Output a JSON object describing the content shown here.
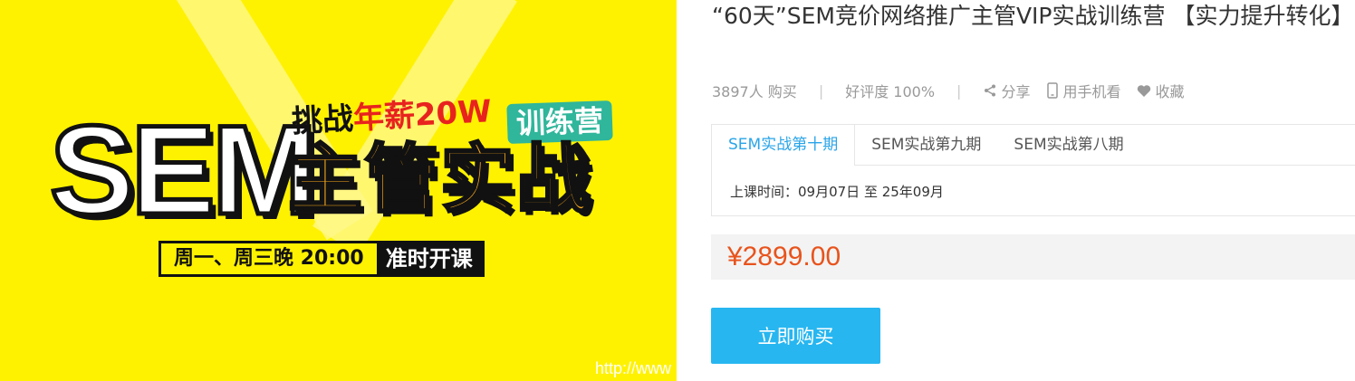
{
  "banner": {
    "sem_text": "SEM",
    "challenge_part1": "挑战",
    "challenge_part2": "年薪20W",
    "camp_badge": "训练营",
    "main_title": "主管实战",
    "schedule_time": "周一、周三晚 20:00",
    "schedule_open": "准时开课",
    "watermark": "http://www"
  },
  "product": {
    "title": "“60天”SEM竞价网络推广主管VIP实战训练营 【实力提升转化】",
    "buyers": "3897人 购买",
    "rating": "好评度 100%",
    "actions": {
      "share": "分享",
      "mobile": "用手机看",
      "favorite": "收藏"
    }
  },
  "tabs": [
    {
      "label": "SEM实战第十期",
      "active": true
    },
    {
      "label": "SEM实战第九期",
      "active": false
    },
    {
      "label": "SEM实战第八期",
      "active": false
    }
  ],
  "schedule_text": "上课时间：09月07日 至 25年09月",
  "price": "¥2899.00",
  "buy_label": "立即购买",
  "colors": {
    "banner_bg": "#fff200",
    "accent_blue": "#27b6f0",
    "active_tab": "#2aa5e8",
    "price": "#e8531c"
  },
  "icons": [
    "share-icon",
    "phone-icon",
    "heart-icon"
  ]
}
